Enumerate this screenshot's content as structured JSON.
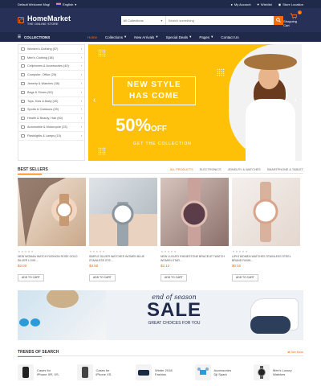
{
  "topbar": {
    "welcome": "Default Welcome Msg!",
    "language": "English",
    "my_account": "My Account",
    "wishlist": "Wishlist",
    "store_location": "Store Location"
  },
  "header": {
    "logo_name": "HomeMarket",
    "logo_tagline": "THE ONLINE STORE",
    "search_category": "All Collections",
    "search_placeholder": "Search something",
    "cart_label": "Shopping Cart",
    "cart_count": "0"
  },
  "nav": {
    "collections": "COLLECTIONS",
    "links": [
      "Home",
      "Collections",
      "New Arrivals",
      "Special Deals",
      "Pages",
      "Contact Us"
    ]
  },
  "sidebar": {
    "items": [
      {
        "label": "Women's Clothing (57)"
      },
      {
        "label": "Men's Clothing (38)"
      },
      {
        "label": "Cellphones & Accessories (40)"
      },
      {
        "label": "Computer, Office (25)"
      },
      {
        "label": "Jewelry & Watches (38)"
      },
      {
        "label": "Bags & Shoes (50)"
      },
      {
        "label": "Toys, Kids & Baby (40)"
      },
      {
        "label": "Sports & Outdoors (39)"
      },
      {
        "label": "Health & Beauty, Hair (60)"
      },
      {
        "label": "Automobile & Motorcycle (23)"
      },
      {
        "label": "Flashlights & Lamps (15)"
      }
    ]
  },
  "banner": {
    "title_line1": "NEW STYLE",
    "title_line2": "HAS COME",
    "percent": "50%",
    "off": "OFF",
    "subtitle": "GET THE COLLECTION"
  },
  "best_sellers": {
    "title": "BEST SELLERS",
    "tabs": [
      "ALL PRODUCTS",
      "ELECTRONICS",
      "JEWELRY & WATCHES",
      "SMARTPHONE & TABLET"
    ],
    "products": [
      {
        "name": "NEW WOMAN WATCH FASHION ROSE GOLD SILVER LOVE...",
        "price": "$2.00",
        "button": "ADD TO CART",
        "stars": "★★★★★"
      },
      {
        "name": "SIMPLE SILVER WATCHES WOMEN BLUE STAINLESS STE...",
        "price": "$3.50",
        "button": "ADD TO CART",
        "stars": "★★★★★"
      },
      {
        "name": "NEW LUXURY RHINESTONE BRACELET WATCH WOMEN STAR...",
        "price": "$2.12",
        "button": "ADD TO CART",
        "stars": "★★★★★"
      },
      {
        "name": "LIPHI WOMEN WATCHES STAINLESS STEEL BRAND FASHI...",
        "price": "$0.50",
        "button": "ADD TO CART",
        "stars": "★★★★★"
      }
    ]
  },
  "promo": {
    "eos": "end of season",
    "sale": "SALE",
    "great": "GREAT CHOICES FOR YOU"
  },
  "trends": {
    "title": "TRENDS OF SEARCH",
    "see_more": "See More",
    "items": [
      {
        "label_line1": "Cases for",
        "label_line2": "iPhone XR, XS,"
      },
      {
        "label_line1": "Cases for",
        "label_line2": "iPhone XS"
      },
      {
        "label_line1": "Winter 2018",
        "label_line2": "Fashion"
      },
      {
        "label_line1": "Accessories",
        "label_line2": "Dji Spark"
      },
      {
        "label_line1": "Men's Luxury",
        "label_line2": "Watches"
      }
    ]
  },
  "colors": {
    "accent": "#ff6a00",
    "header_bg": "#273157",
    "topbar_bg": "#1f2a4a",
    "banner_bg": "#ffc107"
  }
}
